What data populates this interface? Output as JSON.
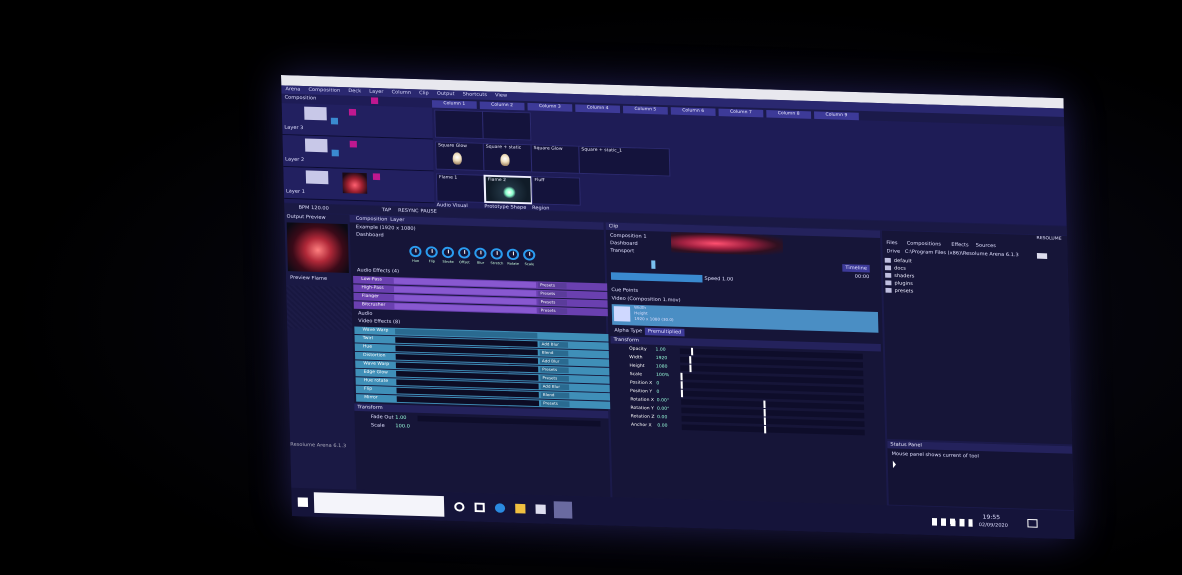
{
  "menu": [
    "Arena",
    "Composition",
    "Deck",
    "Layer",
    "Column",
    "Clip",
    "Output",
    "Shortcuts",
    "View"
  ],
  "columns": [
    "Column 1",
    "Column 2",
    "Column 3",
    "Column 4",
    "Column 5",
    "Column 6",
    "Column 7",
    "Column 8",
    "Column 9"
  ],
  "layer_labels": [
    "Composition",
    "Layer 3",
    "Layer 2",
    "Layer 1"
  ],
  "clips_row2": [
    "Square Glow",
    "Square + static",
    "Square Glow",
    "Square + static_1"
  ],
  "clips_row3": [
    "Flame 1",
    "Flame 2",
    "Fluff"
  ],
  "clip_row3_extra": [
    "Audio Visual",
    "Prototype Shape",
    "Region"
  ],
  "transport": {
    "bpm": "BPM 120.00",
    "tap": "TAP",
    "resync": "RESYNC",
    "pause": "PAUSE"
  },
  "output_preview": {
    "title": "Output Preview",
    "source": "Preview Flame"
  },
  "composition_tab": {
    "tabs": [
      "Composition",
      "Layer"
    ],
    "name": "Example (1920 x 1080)",
    "dashboard": "Dashboard"
  },
  "knobs": [
    "Hue",
    "Flip",
    "Stroke",
    "Offset",
    "Blur",
    "Stretch",
    "Rotate",
    "Scale"
  ],
  "audio_effects_title": "Audio Effects (4)",
  "audio_effects": [
    {
      "name": "Low-Pass",
      "preset": "Presets"
    },
    {
      "name": "High-Pass",
      "preset": "Presets"
    },
    {
      "name": "Flanger",
      "preset": "Presets"
    },
    {
      "name": "Bitcrusher",
      "preset": "Presets"
    }
  ],
  "audio_label": "Audio",
  "video_effects_title": "Video Effects (8)",
  "video_effects": [
    {
      "name": "Wave Warp",
      "preset": ""
    },
    {
      "name": "Twirl",
      "preset": "Add Blur"
    },
    {
      "name": "Hue",
      "preset": "Blend"
    },
    {
      "name": "Distortion",
      "preset": "Add Blur"
    },
    {
      "name": "Wave Warp",
      "preset": "Presets"
    },
    {
      "name": "Edge Glow",
      "preset": "Presets"
    },
    {
      "name": "Hue rotate",
      "preset": "Add Blur"
    },
    {
      "name": "Flip",
      "preset": "Blend"
    },
    {
      "name": "Mirror",
      "preset": "Presets"
    }
  ],
  "transform_label": "Transform",
  "fade_rows": [
    {
      "label": "Fade Out",
      "value": "1.00"
    },
    {
      "label": "Scale",
      "value": "100.0"
    }
  ],
  "clip_panel": {
    "title": "Clip",
    "name": "Composition 1",
    "sections": [
      "Dashboard",
      "Transport"
    ],
    "timecode": "00:00",
    "timeline_label": "Timeline",
    "speed": "Speed 1.00",
    "cue_points": "Cue Points",
    "video_section": "Video (Composition 1.mov)",
    "video_info": [
      "Width",
      "Height",
      "1920 x 1080 (30.0)"
    ],
    "alpha_label": "Alpha Type",
    "alpha_value": "Premultiplied"
  },
  "transform_rows": [
    {
      "label": "Opacity",
      "value": "1.00"
    },
    {
      "label": "Width",
      "value": "1920"
    },
    {
      "label": "Height",
      "value": "1080"
    },
    {
      "label": "Scale",
      "value": "100%"
    },
    {
      "label": "Position X",
      "value": "0"
    },
    {
      "label": "Position Y",
      "value": "0"
    },
    {
      "label": "Rotation X",
      "value": "0.00°"
    },
    {
      "label": "Rotation Y",
      "value": "0.00°"
    },
    {
      "label": "Rotation Z",
      "value": "0.00"
    },
    {
      "label": "Anchor X",
      "value": "0.00"
    }
  ],
  "files_panel": {
    "tabs": [
      "Files",
      "Compositions",
      "Effects",
      "Sources"
    ],
    "drive": "Drive",
    "path": "C:\\Program Files (x86)\\Resolume Arena 6.1.3",
    "folders": [
      "default",
      "docs",
      "shaders",
      "plugins",
      "presets"
    ],
    "corner": "RESOLUME"
  },
  "hint_panel": {
    "title": "Status Panel",
    "text": "Mouse panel shows current of tool"
  },
  "status_footer": "Resolume Arena 6.1.3",
  "taskbar": {
    "time": "19:55",
    "date": "02/09/2020"
  },
  "colors": {
    "accent_purple": "#8a5cd0",
    "accent_blue": "#3aa6e0",
    "panel": "#161538",
    "highlight_pink": "#d0305a"
  }
}
